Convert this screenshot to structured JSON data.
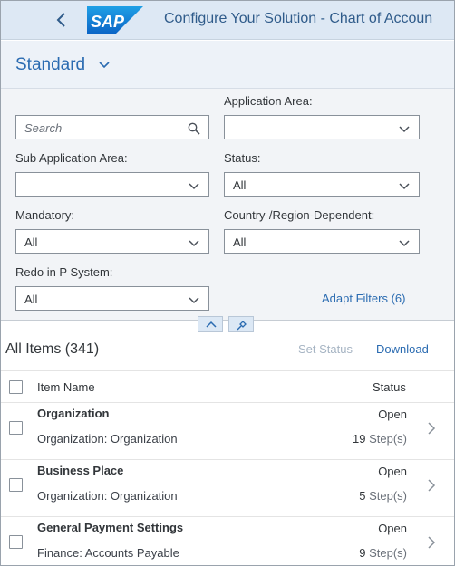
{
  "shell": {
    "logo_text": "SAP",
    "title": "Configure Your Solution - Chart of Accoun"
  },
  "variant": {
    "name": "Standard"
  },
  "filters": {
    "search": {
      "placeholder": "Search",
      "value": ""
    },
    "application_area": {
      "label": "Application Area:",
      "value": ""
    },
    "sub_application_area": {
      "label": "Sub Application Area:",
      "value": ""
    },
    "status": {
      "label": "Status:",
      "value": "All"
    },
    "mandatory": {
      "label": "Mandatory:",
      "value": "All"
    },
    "country_region_dependent": {
      "label": "Country-/Region-Dependent:",
      "value": "All"
    },
    "redo_in_p_system": {
      "label": "Redo in P System:",
      "value": "All"
    },
    "adapt_filters": "Adapt Filters (6)"
  },
  "table": {
    "title": "All Items (341)",
    "actions": {
      "set_status": "Set Status",
      "download": "Download"
    },
    "columns": {
      "item_name": "Item Name",
      "status": "Status"
    },
    "rows": [
      {
        "name": "Organization",
        "area": "Organization: Organization",
        "status": "Open",
        "steps": "19",
        "steps_unit": "Step(s)"
      },
      {
        "name": "Business Place",
        "area": "Organization: Organization",
        "status": "Open",
        "steps": "5",
        "steps_unit": "Step(s)"
      },
      {
        "name": "General Payment Settings",
        "area": "Finance: Accounts Payable",
        "status": "Open",
        "steps": "9",
        "steps_unit": "Step(s)"
      }
    ]
  },
  "colors": {
    "brand_blue": "#2a6bb1",
    "shell_bg": "#dde8f4",
    "filter_bg": "#f2f4f7"
  }
}
